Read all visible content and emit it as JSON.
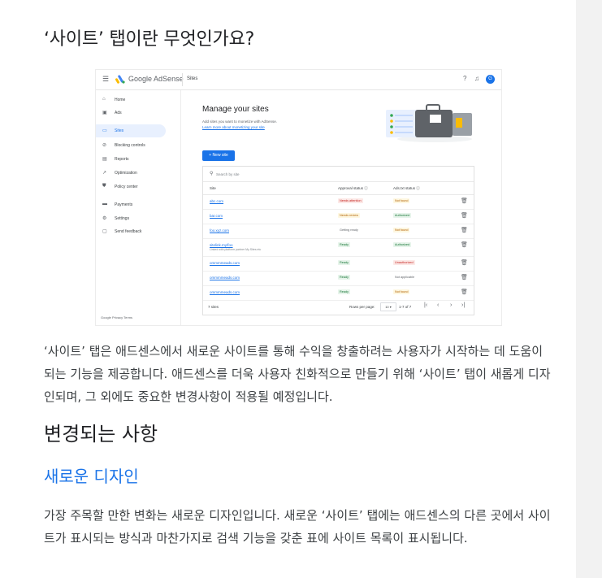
{
  "article": {
    "title": "‘사이트’ 탭이란 무엇인가요?",
    "intro": "‘사이트’ 탭은 애드센스에서 새로운 사이트를 통해 수익을 창출하려는 사용자가 시작하는 데 도움이 되는 기능을 제공합니다. 애드센스를 더욱 사용자 친화적으로 만들기 위해 ‘사이트’ 탭이 새롭게 디자인되며, 그 외에도 중요한 변경사항이 적용될 예정입니다.",
    "section_heading": "변경되는 사항",
    "subsection_heading": "새로운 디자인",
    "subsection_body": "가장 주목할 만한 변화는 새로운 디자인입니다. 새로운 ‘사이트’ 탭에는 애드센스의 다른 곳에서 사이트가 표시되는 방식과 마찬가지로 검색 기능을 갖춘 표에 사이트 목록이 표시됩니다."
  },
  "screenshot": {
    "brand_google": "Google",
    "brand_product": "AdSense",
    "breadcrumb": "Sites",
    "avatar_letter": "G",
    "nav": [
      {
        "label": "Home",
        "icon": "home-icon",
        "glyph": "⌂"
      },
      {
        "label": "Ads",
        "icon": "ads-icon",
        "glyph": "▣"
      },
      {
        "label": "Sites",
        "icon": "sites-icon",
        "glyph": "▭"
      },
      {
        "label": "Blocking controls",
        "icon": "block-icon",
        "glyph": "⊘"
      },
      {
        "label": "Reports",
        "icon": "reports-icon",
        "glyph": "▤"
      },
      {
        "label": "Optimization",
        "icon": "optimization-icon",
        "glyph": "↗"
      },
      {
        "label": "Policy center",
        "icon": "policy-icon",
        "glyph": "⛊"
      },
      {
        "label": "Payments",
        "icon": "payments-icon",
        "glyph": "▬"
      },
      {
        "label": "Settings",
        "icon": "settings-icon",
        "glyph": "⚙"
      },
      {
        "label": "Send feedback",
        "icon": "feedback-icon",
        "glyph": "▢"
      }
    ],
    "footer": "Google  Privacy  Terms",
    "main_title": "Manage your sites",
    "main_subtitle": "Add sites you want to monetize with AdSense.",
    "main_link": "Learn more about monetizing your site",
    "new_site_button": "+  New site",
    "search_placeholder": "Search by site",
    "columns": {
      "site": "Site",
      "approval": "Approval status",
      "ads_txt": "Ads.txt status"
    },
    "rows": [
      {
        "site": "abc.com",
        "sub": "",
        "approval": "Needs attention",
        "approval_style": "red",
        "ads_txt": "Not found",
        "ads_style": "yel"
      },
      {
        "site": "bar.com",
        "sub": "",
        "approval": "Needs review",
        "approval_style": "yel",
        "ads_txt": "Authorized",
        "ads_style": "grn"
      },
      {
        "site": "foo.xyz.com",
        "sub": "",
        "approval": "Getting ready",
        "approval_style": "plain",
        "ads_txt": "Not found",
        "ads_style": "yel"
      },
      {
        "site": "sitelink.my/foo",
        "sub": "Linked with platform partner My Sites etc",
        "approval": "Ready",
        "approval_style": "grn",
        "ads_txt": "Authorized",
        "ads_style": "grn"
      },
      {
        "site": "ommmmeads.com",
        "sub": "",
        "approval": "Ready",
        "approval_style": "grn",
        "ads_txt": "Unauthorized",
        "ads_style": "red"
      },
      {
        "site": "ommmmeads.com",
        "sub": "",
        "approval": "Ready",
        "approval_style": "grn",
        "ads_txt": "Not applicable",
        "ads_style": "plain"
      },
      {
        "site": "ommmmeads.com",
        "sub": "",
        "approval": "Ready",
        "approval_style": "grn",
        "ads_txt": "Not found",
        "ads_style": "yel"
      }
    ],
    "footer_count": "7 sites",
    "rows_per_page_label": "Rows per page:",
    "rows_per_page_value": "10  ▾",
    "range": "1-7 of 7",
    "colors": {
      "accent": "#1a73e8",
      "link": "#1a73e8"
    }
  }
}
